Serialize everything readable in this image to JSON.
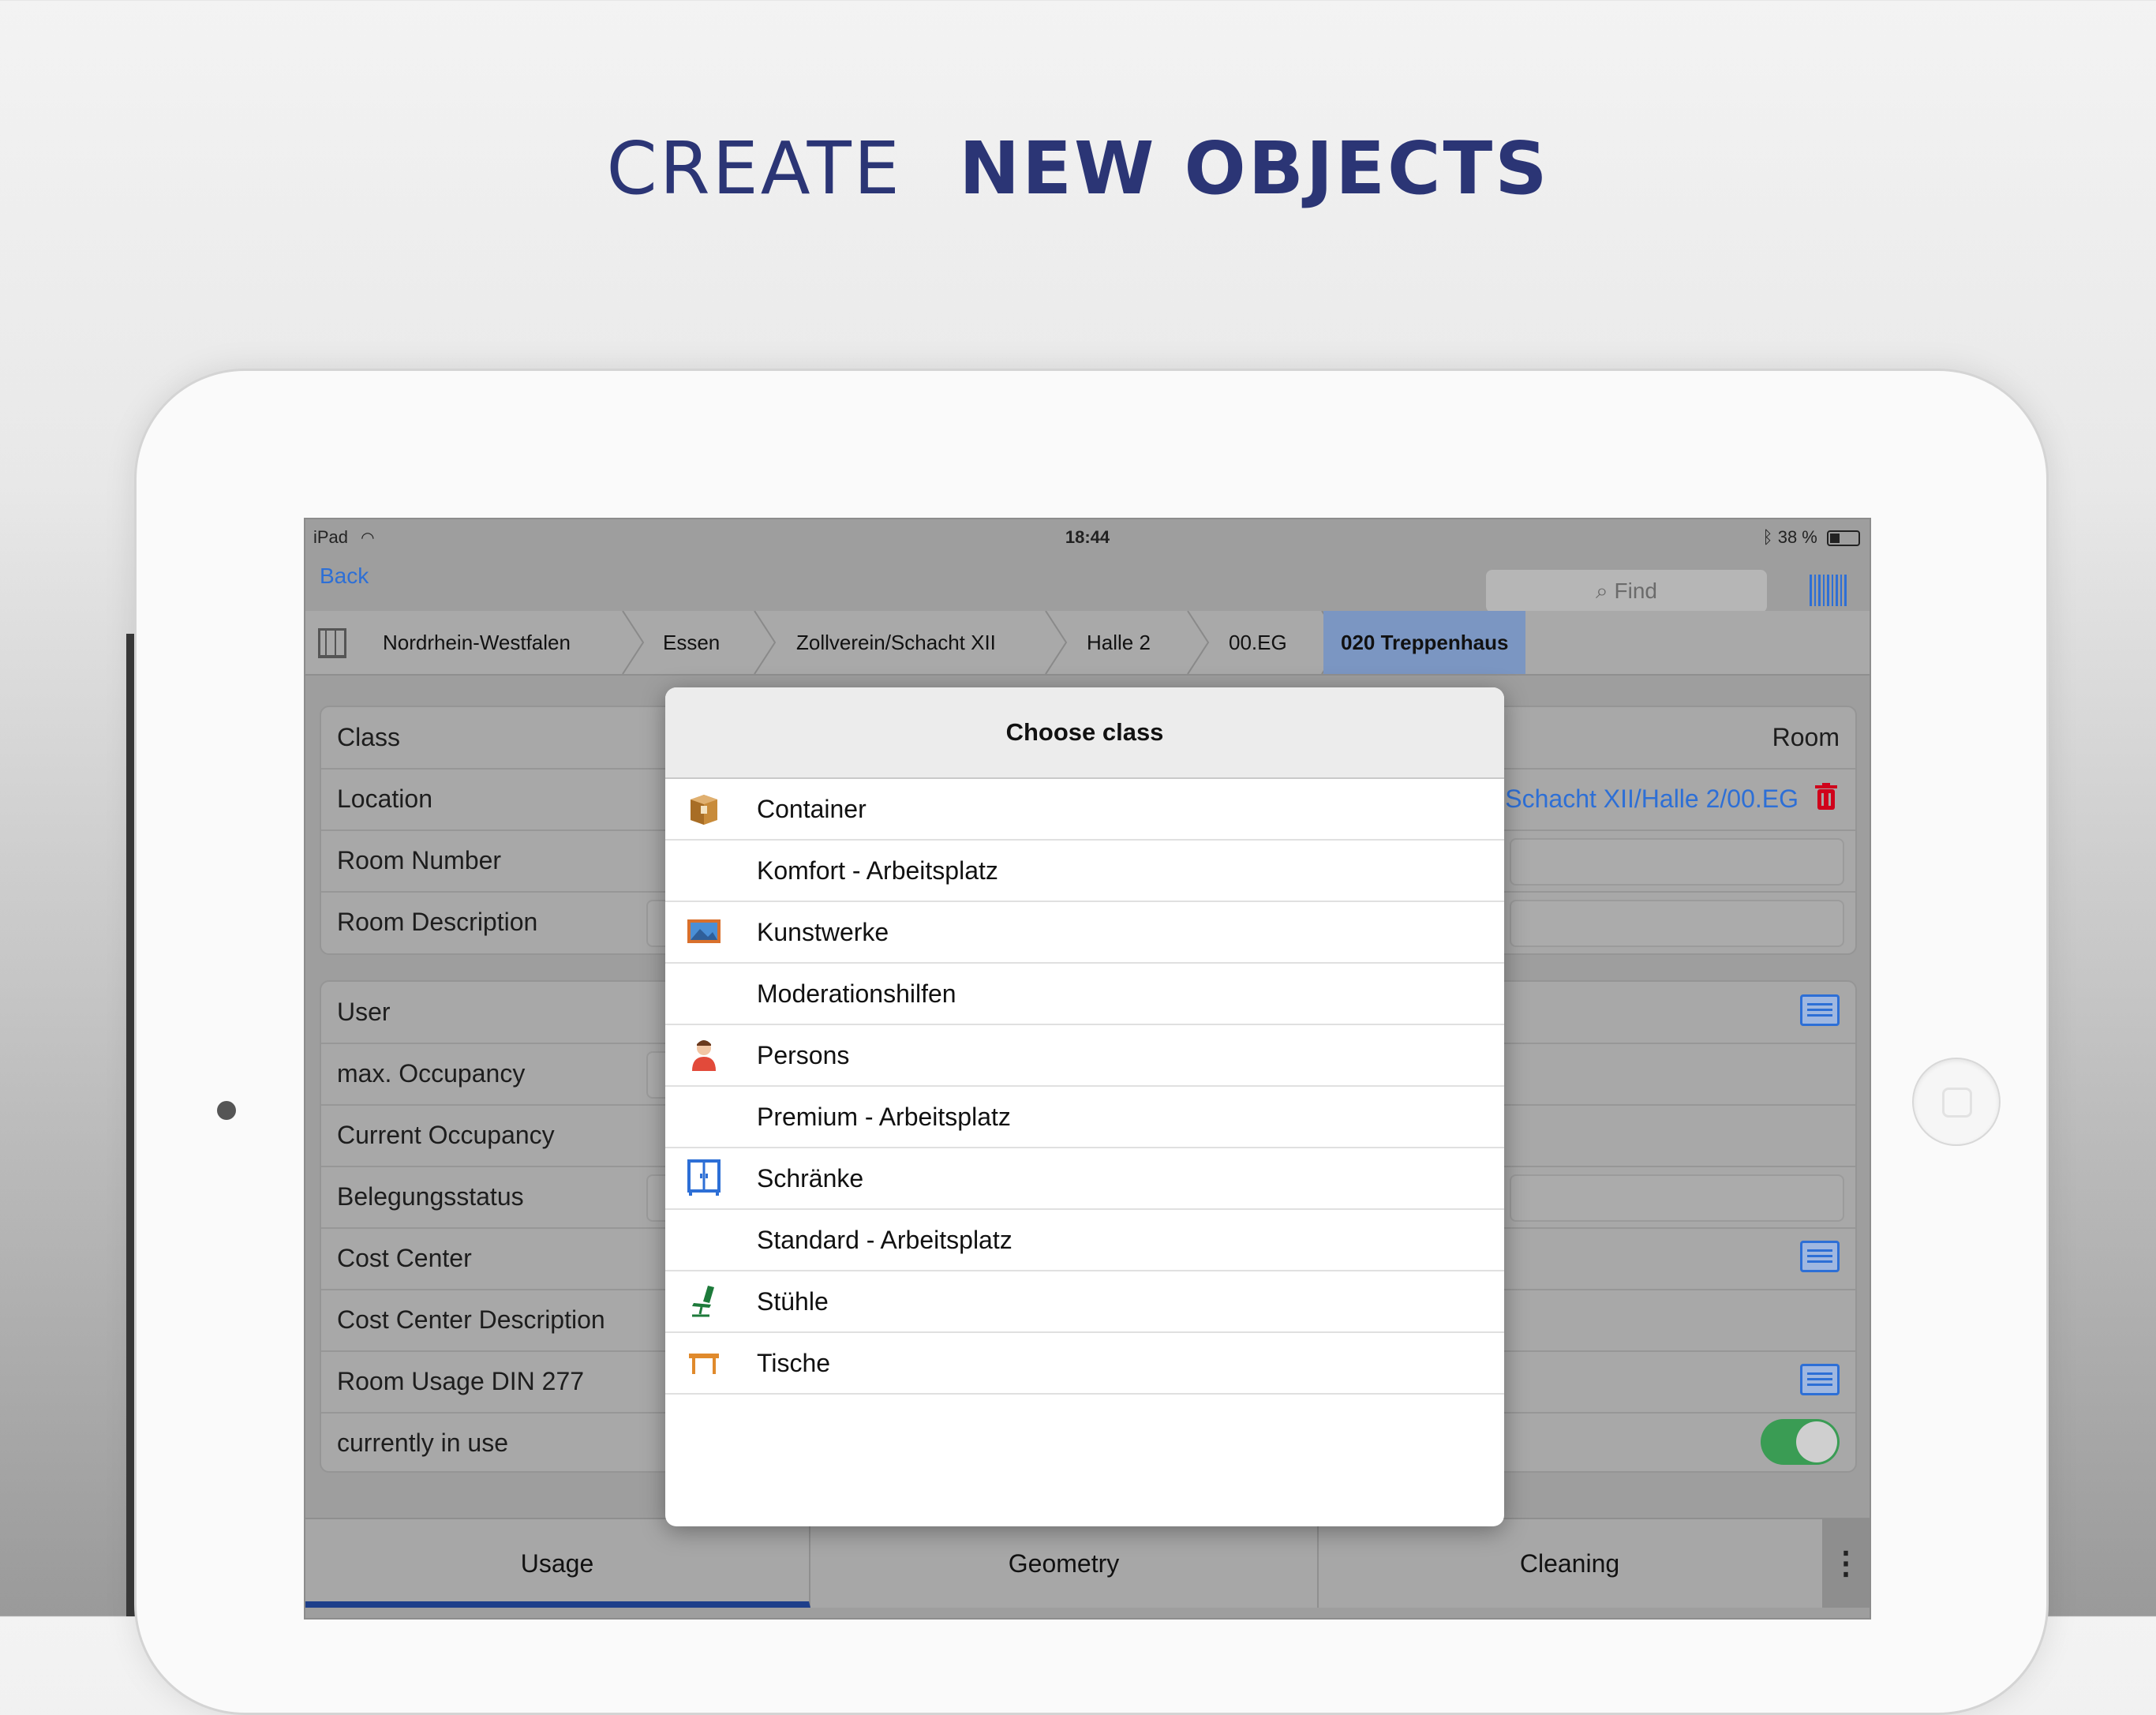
{
  "headline": {
    "thin": "CREATE",
    "bold": "NEW OBJECTS"
  },
  "status": {
    "device": "iPad",
    "time": "18:44",
    "battery": "38 %"
  },
  "nav": {
    "back": "Back",
    "find_placeholder": "Find"
  },
  "breadcrumb": {
    "items": [
      "Nordrhein-Westfalen",
      "Essen",
      "Zollverein/Schacht XII",
      "Halle 2",
      "00.EG"
    ],
    "active": "020 Treppenhaus"
  },
  "form": {
    "card1": {
      "class": {
        "label": "Class",
        "value": "Room"
      },
      "location": {
        "label": "Location",
        "value": "Schacht XII/Halle 2/00.EG"
      },
      "room_number": {
        "label": "Room Number"
      },
      "room_description": {
        "label": "Room Description"
      }
    },
    "card2": {
      "user": "User",
      "max_occupancy": "max. Occupancy",
      "current_occupancy": "Current Occupancy",
      "belegungsstatus": "Belegungsstatus",
      "cost_center": "Cost Center",
      "cost_center_description": "Cost Center Description",
      "room_usage": "Room Usage DIN 277",
      "currently_in_use": "currently in use"
    }
  },
  "tabs": [
    "Usage",
    "Geometry",
    "Cleaning"
  ],
  "modal": {
    "title": "Choose class",
    "items": [
      {
        "label": "Container",
        "icon": "box-icon"
      },
      {
        "label": "Komfort - Arbeitsplatz",
        "icon": ""
      },
      {
        "label": "Kunstwerke",
        "icon": "picture-icon"
      },
      {
        "label": "Moderationshilfen",
        "icon": ""
      },
      {
        "label": "Persons",
        "icon": "person-icon"
      },
      {
        "label": "Premium - Arbeitsplatz",
        "icon": ""
      },
      {
        "label": "Schränke",
        "icon": "cabinet-icon"
      },
      {
        "label": "Standard - Arbeitsplatz",
        "icon": ""
      },
      {
        "label": "Stühle",
        "icon": "chair-icon"
      },
      {
        "label": "Tische",
        "icon": "table-icon"
      }
    ]
  },
  "colors": {
    "accent": "#2d6fd6",
    "headline": "#2b3575",
    "active_crumb": "#7b96c2",
    "toggle_on": "#3a9c54"
  }
}
